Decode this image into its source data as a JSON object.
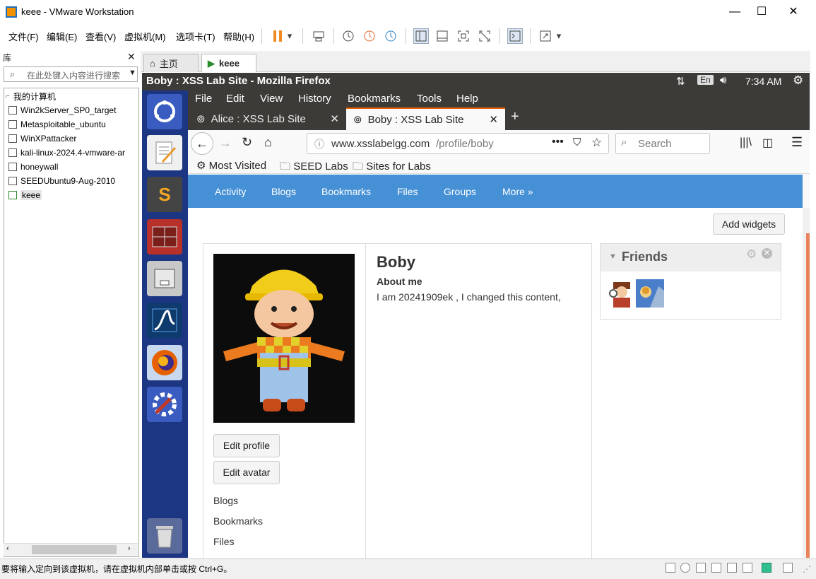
{
  "window": {
    "title": "keee - VMware Workstation",
    "minimize": "—",
    "maximize": "☐",
    "close": "✕"
  },
  "menu": [
    "文件(F)",
    "编辑(E)",
    "查看(V)",
    "虚拟机(M)",
    "选项卡(T)",
    "帮助(H)"
  ],
  "library": {
    "title": "库",
    "close": "✕",
    "search_placeholder": "在此处键入内容进行搜索",
    "root": "我的计算机",
    "vms": [
      "Win2kServer_SP0_target",
      "Metasploitable_ubuntu",
      "WinXPattacker",
      "kali-linux-2024.4-vmware-ar",
      "honeywall",
      "SEEDUbuntu9-Aug-2010",
      "keee"
    ]
  },
  "vm_tabs": [
    {
      "label": "主页"
    },
    {
      "label": "keee"
    }
  ],
  "guest": {
    "window_title": "Boby : XSS Lab Site - Mozilla Firefox",
    "lang": "En",
    "time": "7:34 AM"
  },
  "firefox": {
    "menu": [
      "File",
      "Edit",
      "View",
      "History",
      "Bookmarks",
      "Tools",
      "Help"
    ],
    "tabs": [
      {
        "label": "Alice : XSS Lab Site",
        "active": false
      },
      {
        "label": "Boby : XSS Lab Site",
        "active": true
      }
    ],
    "url_domain": "www.xsslabelgg.com",
    "url_path": "/profile/boby",
    "search_placeholder": "Search",
    "bookmarks": [
      "Most Visited",
      "SEED Labs",
      "Sites for Labs"
    ]
  },
  "elgg": {
    "nav": [
      "Activity",
      "Blogs",
      "Bookmarks",
      "Files",
      "Groups",
      "More »"
    ],
    "add_widgets": "Add widgets",
    "profile": {
      "name": "Boby",
      "about_heading": "About me",
      "about_text": "I am 20241909ek , I changed this content,",
      "edit_profile": "Edit profile",
      "edit_avatar": "Edit avatar",
      "links": [
        "Blogs",
        "Bookmarks",
        "Files"
      ]
    },
    "friends_title": "Friends"
  },
  "status": {
    "text": "要将输入定向到该虚拟机，请在虚拟机内部单击或按 Ctrl+G。"
  },
  "colors": {
    "elgg_nav": "#4690d6",
    "ubuntu_panel": "#3c3b37",
    "launcher": "#1d3683",
    "active_tab_accent": "#e66000"
  }
}
